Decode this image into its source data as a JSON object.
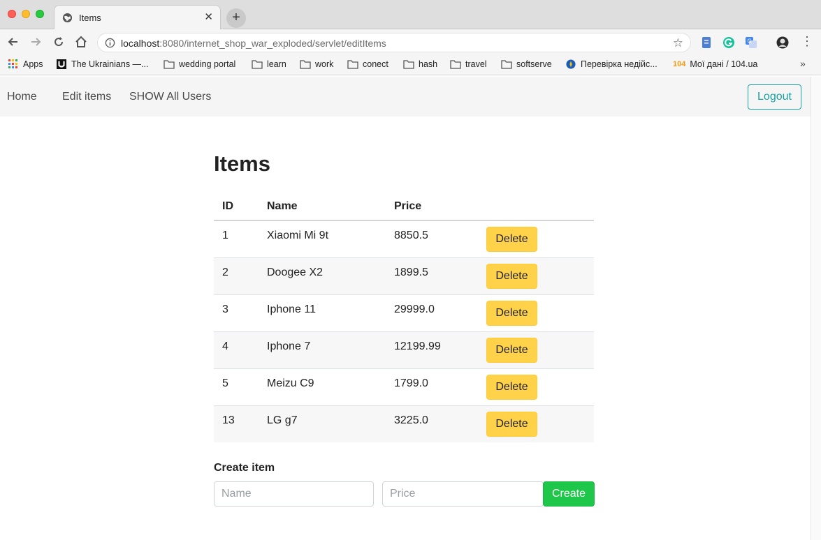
{
  "browser": {
    "tab_title": "Items",
    "new_tab_label": "+",
    "url_host": "localhost",
    "url_rest": ":8080/internet_shop_war_exploded/servlet/editItems",
    "bookmarks": [
      {
        "label": "Apps",
        "icon": "apps-grid-icon"
      },
      {
        "label": "The Ukrainians —...",
        "icon": "ukrainians-logo-icon"
      },
      {
        "label": "wedding portal",
        "icon": "folder-icon"
      },
      {
        "label": "learn",
        "icon": "folder-icon"
      },
      {
        "label": "work",
        "icon": "folder-icon"
      },
      {
        "label": "conect",
        "icon": "folder-icon"
      },
      {
        "label": "hash",
        "icon": "folder-icon"
      },
      {
        "label": "travel",
        "icon": "folder-icon"
      },
      {
        "label": "softserve",
        "icon": "folder-icon"
      },
      {
        "label": "Перевірка недійс...",
        "icon": "ukraine-emblem-icon"
      },
      {
        "label": "Мої дані / 104.ua",
        "icon": "104-logo-icon"
      }
    ],
    "badge_104": "104",
    "more_label": "»"
  },
  "navbar": {
    "home": "Home",
    "edit_items": "Edit items",
    "show_users": "SHOW All Users",
    "logout": "Logout"
  },
  "page": {
    "title": "Items",
    "table": {
      "headers": [
        "ID",
        "Name",
        "Price"
      ],
      "rows": [
        {
          "id": "1",
          "name": "Xiaomi Mi 9t",
          "price": "8850.5",
          "action": "Delete"
        },
        {
          "id": "2",
          "name": "Doogee X2",
          "price": "1899.5",
          "action": "Delete"
        },
        {
          "id": "3",
          "name": "Iphone 11",
          "price": "29999.0",
          "action": "Delete"
        },
        {
          "id": "4",
          "name": "Iphone 7",
          "price": "12199.99",
          "action": "Delete"
        },
        {
          "id": "5",
          "name": "Meizu C9",
          "price": "1799.0",
          "action": "Delete"
        },
        {
          "id": "13",
          "name": "LG g7",
          "price": "3225.0",
          "action": "Delete"
        }
      ]
    },
    "create": {
      "label": "Create item",
      "name_placeholder": "Name",
      "price_placeholder": "Price",
      "button": "Create"
    }
  },
  "colors": {
    "delete": "#ffd24a",
    "create": "#1ec64a",
    "logout": "#17a2a0"
  }
}
